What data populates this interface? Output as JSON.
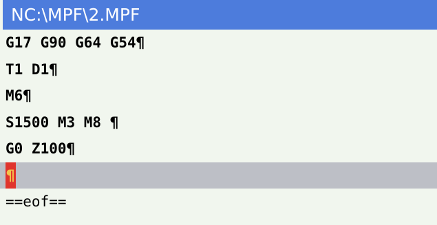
{
  "window": {
    "title": "NC:\\MPF\\2.MPF"
  },
  "editor": {
    "lines": [
      "G17 G90 G64 G54¶",
      "T1 D1¶",
      "M6¶",
      "S1500 M3 M8 ¶",
      "G0 Z100¶"
    ],
    "current_line": {
      "text": "¶"
    },
    "eof_marker": "==eof=="
  },
  "colors": {
    "titlebar_bg": "#4d7cdc",
    "editor_bg": "#f1f6ee",
    "current_line_bg": "#bdbfc6",
    "cursor_bg": "#e0342c",
    "cursor_fg": "#f3c34c"
  }
}
